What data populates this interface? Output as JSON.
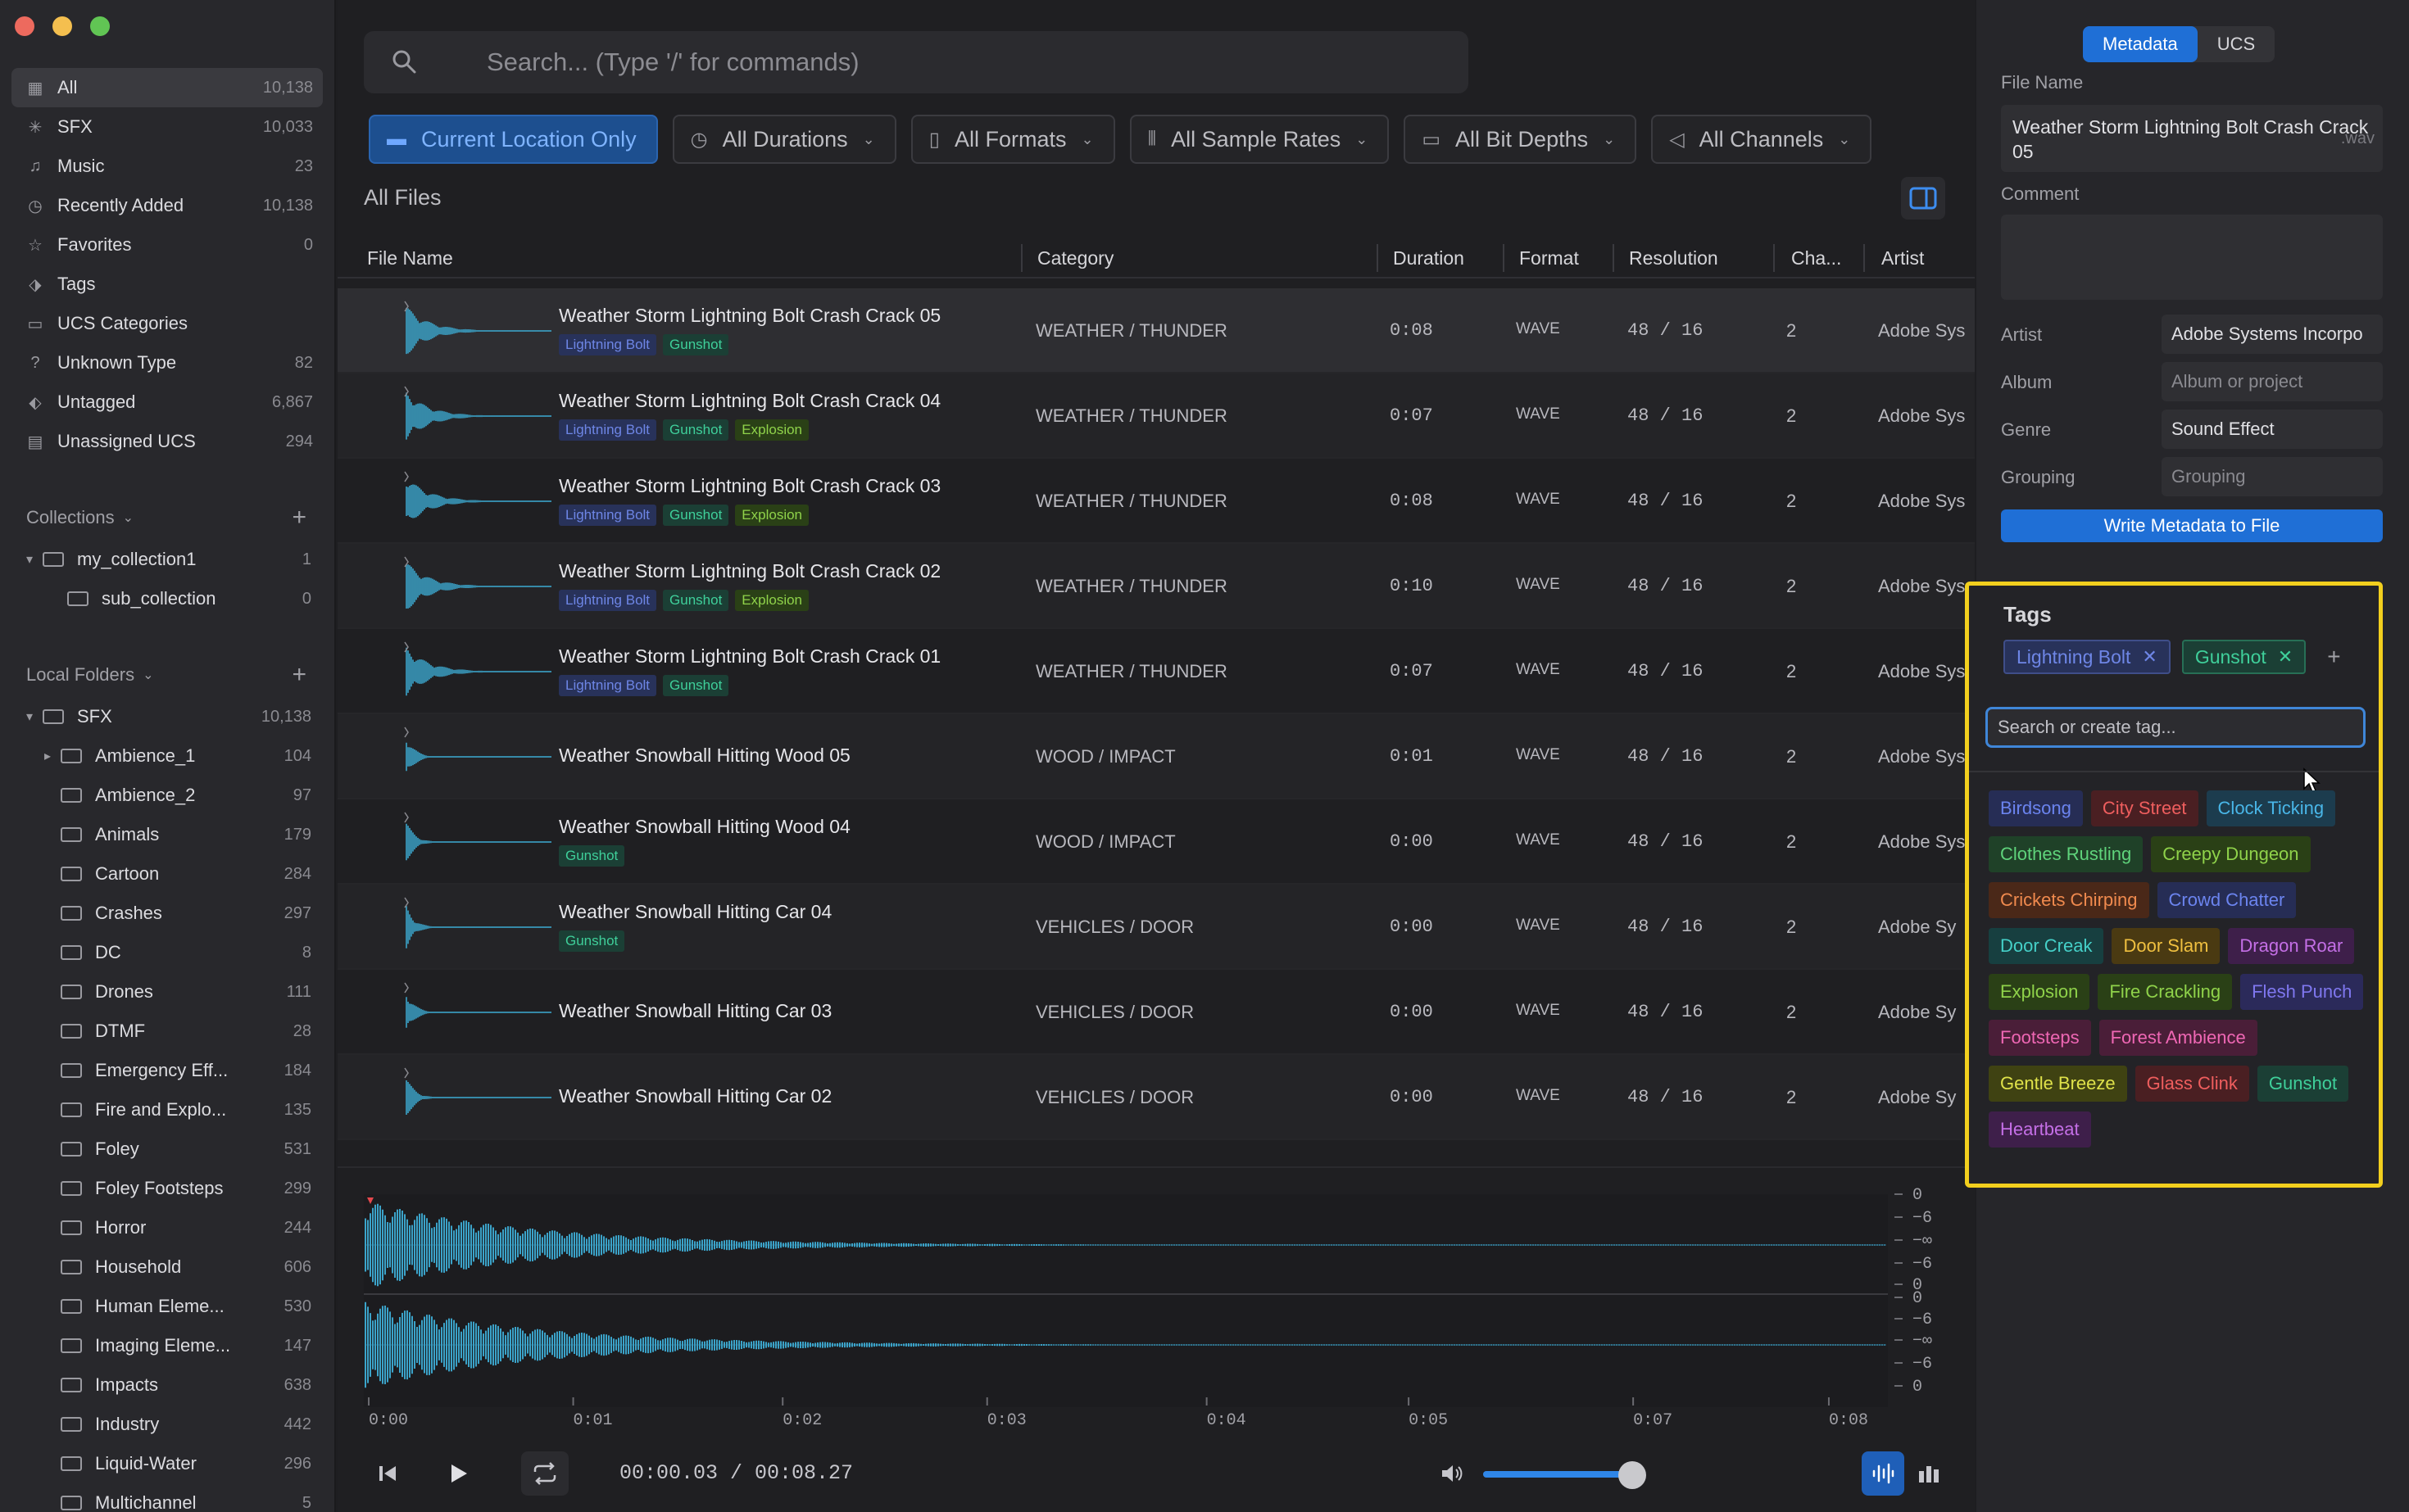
{
  "sidebar": {
    "items": [
      {
        "label": "All",
        "count": "10,138",
        "icon": "grid-icon"
      },
      {
        "label": "SFX",
        "count": "10,033",
        "icon": "sparkle-icon"
      },
      {
        "label": "Music",
        "count": "23",
        "icon": "music-note-icon"
      },
      {
        "label": "Recently Added",
        "count": "10,138",
        "icon": "clock-icon"
      },
      {
        "label": "Favorites",
        "count": "0",
        "icon": "star-icon"
      },
      {
        "label": "Tags",
        "count": "",
        "icon": "tag-icon"
      },
      {
        "label": "UCS Categories",
        "count": "",
        "icon": "folder-icon"
      },
      {
        "label": "Unknown Type",
        "count": "82",
        "icon": "question-icon"
      },
      {
        "label": "Untagged",
        "count": "6,867",
        "icon": "untagged-icon"
      },
      {
        "label": "Unassigned UCS",
        "count": "294",
        "icon": "inbox-icon"
      }
    ],
    "collections_label": "Collections",
    "collections": [
      {
        "label": "my_collection1",
        "count": "1"
      },
      {
        "label": "sub_collection",
        "count": "0"
      }
    ],
    "local_folders_label": "Local Folders",
    "root_folder": {
      "label": "SFX",
      "count": "10,138"
    },
    "folders": [
      {
        "label": "Ambience_1",
        "count": "104"
      },
      {
        "label": "Ambience_2",
        "count": "97"
      },
      {
        "label": "Animals",
        "count": "179"
      },
      {
        "label": "Cartoon",
        "count": "284"
      },
      {
        "label": "Crashes",
        "count": "297"
      },
      {
        "label": "DC",
        "count": "8"
      },
      {
        "label": "Drones",
        "count": "111"
      },
      {
        "label": "DTMF",
        "count": "28"
      },
      {
        "label": "Emergency Eff...",
        "count": "184"
      },
      {
        "label": "Fire and Explo...",
        "count": "135"
      },
      {
        "label": "Foley",
        "count": "531"
      },
      {
        "label": "Foley Footsteps",
        "count": "299"
      },
      {
        "label": "Horror",
        "count": "244"
      },
      {
        "label": "Household",
        "count": "606"
      },
      {
        "label": "Human Eleme...",
        "count": "530"
      },
      {
        "label": "Imaging Eleme...",
        "count": "147"
      },
      {
        "label": "Impacts",
        "count": "638"
      },
      {
        "label": "Industry",
        "count": "442"
      },
      {
        "label": "Liquid-Water",
        "count": "296"
      },
      {
        "label": "Multichannel",
        "count": "5"
      }
    ]
  },
  "search": {
    "placeholder": "Search... (Type '/' for commands)"
  },
  "filters": [
    "Current Location Only",
    "All Durations",
    "All Formats",
    "All Sample Rates",
    "All Bit Depths",
    "All Channels"
  ],
  "section_title": "All Files",
  "columns": [
    "File Name",
    "Category",
    "Duration",
    "Format",
    "Resolution",
    "Cha...",
    "Artist"
  ],
  "rows": [
    {
      "name": "Weather Storm Lightning Bolt Crash Crack 05",
      "tags": [
        "Lightning Bolt",
        "Gunshot"
      ],
      "category": "WEATHER / THUNDER",
      "duration": "0:08",
      "format": "WAVE",
      "resolution": "48 / 16",
      "channels": "2",
      "artist": "Adobe Sys"
    },
    {
      "name": "Weather Storm Lightning Bolt Crash Crack 04",
      "tags": [
        "Lightning Bolt",
        "Gunshot",
        "Explosion"
      ],
      "category": "WEATHER / THUNDER",
      "duration": "0:07",
      "format": "WAVE",
      "resolution": "48 / 16",
      "channels": "2",
      "artist": "Adobe Sys"
    },
    {
      "name": "Weather Storm Lightning Bolt Crash Crack 03",
      "tags": [
        "Lightning Bolt",
        "Gunshot",
        "Explosion"
      ],
      "category": "WEATHER / THUNDER",
      "duration": "0:08",
      "format": "WAVE",
      "resolution": "48 / 16",
      "channels": "2",
      "artist": "Adobe Sys"
    },
    {
      "name": "Weather Storm Lightning Bolt Crash Crack 02",
      "tags": [
        "Lightning Bolt",
        "Gunshot",
        "Explosion"
      ],
      "category": "WEATHER / THUNDER",
      "duration": "0:10",
      "format": "WAVE",
      "resolution": "48 / 16",
      "channels": "2",
      "artist": "Adobe Sys"
    },
    {
      "name": "Weather Storm Lightning Bolt Crash Crack 01",
      "tags": [
        "Lightning Bolt",
        "Gunshot"
      ],
      "category": "WEATHER / THUNDER",
      "duration": "0:07",
      "format": "WAVE",
      "resolution": "48 / 16",
      "channels": "2",
      "artist": "Adobe Sys"
    },
    {
      "name": "Weather Snowball Hitting Wood 05",
      "tags": [],
      "category": "WOOD / IMPACT",
      "duration": "0:01",
      "format": "WAVE",
      "resolution": "48 / 16",
      "channels": "2",
      "artist": "Adobe Sys"
    },
    {
      "name": "Weather Snowball Hitting Wood 04",
      "tags": [
        "Gunshot"
      ],
      "category": "WOOD / IMPACT",
      "duration": "0:00",
      "format": "WAVE",
      "resolution": "48 / 16",
      "channels": "2",
      "artist": "Adobe Sys"
    },
    {
      "name": "Weather Snowball Hitting Car 04",
      "tags": [
        "Gunshot"
      ],
      "category": "VEHICLES / DOOR",
      "duration": "0:00",
      "format": "WAVE",
      "resolution": "48 / 16",
      "channels": "2",
      "artist": "Adobe Sy"
    },
    {
      "name": "Weather Snowball Hitting Car 03",
      "tags": [],
      "category": "VEHICLES / DOOR",
      "duration": "0:00",
      "format": "WAVE",
      "resolution": "48 / 16",
      "channels": "2",
      "artist": "Adobe Sy"
    },
    {
      "name": "Weather Snowball Hitting Car 02",
      "tags": [],
      "category": "VEHICLES / DOOR",
      "duration": "0:00",
      "format": "WAVE",
      "resolution": "48 / 16",
      "channels": "2",
      "artist": "Adobe Sy"
    }
  ],
  "player": {
    "time_ticks": [
      "0:00",
      "0:01",
      "0:02",
      "0:03",
      "0:04",
      "0:05",
      "0:07",
      "0:08"
    ],
    "db_ticks": [
      "0",
      "−6",
      "−∞",
      "−6",
      "0",
      "0",
      "−6",
      "−∞",
      "−6",
      "0"
    ],
    "time_display": "00:00.03 / 00:08.27",
    "volume": 0.92
  },
  "right_panel": {
    "tabs": [
      "Metadata",
      "UCS"
    ],
    "file_name_label": "File Name",
    "file_name": "Weather Storm Lightning Bolt Crash Crack 05",
    "file_ext": ".wav",
    "comment_label": "Comment",
    "fields": [
      {
        "label": "Artist",
        "value": "Adobe Systems Incorpo",
        "placeholder": false
      },
      {
        "label": "Album",
        "value": "Album or project",
        "placeholder": true
      },
      {
        "label": "Genre",
        "value": "Sound Effect",
        "placeholder": false
      },
      {
        "label": "Grouping",
        "value": "Grouping",
        "placeholder": true
      }
    ],
    "write_button": "Write Metadata to File"
  },
  "tags_popover": {
    "title": "Tags",
    "current": [
      "Lightning Bolt",
      "Gunshot"
    ],
    "search_placeholder": "Search or create tag...",
    "options": [
      "Birdsong",
      "City Street",
      "Clock Ticking",
      "Clothes Rustling",
      "Creepy Dungeon",
      "Crickets Chirping",
      "Crowd Chatter",
      "Door Creak",
      "Door Slam",
      "Dragon Roar",
      "Explosion",
      "Fire Crackling",
      "Flesh Punch",
      "Footsteps",
      "Forest Ambience",
      "Gentle Breeze",
      "Glass Clink",
      "Gunshot",
      "Heartbeat"
    ]
  },
  "colors": {
    "accent": "#1f6fd6",
    "highlight": "#f2cf1e",
    "wave": "#3ba3c9"
  }
}
